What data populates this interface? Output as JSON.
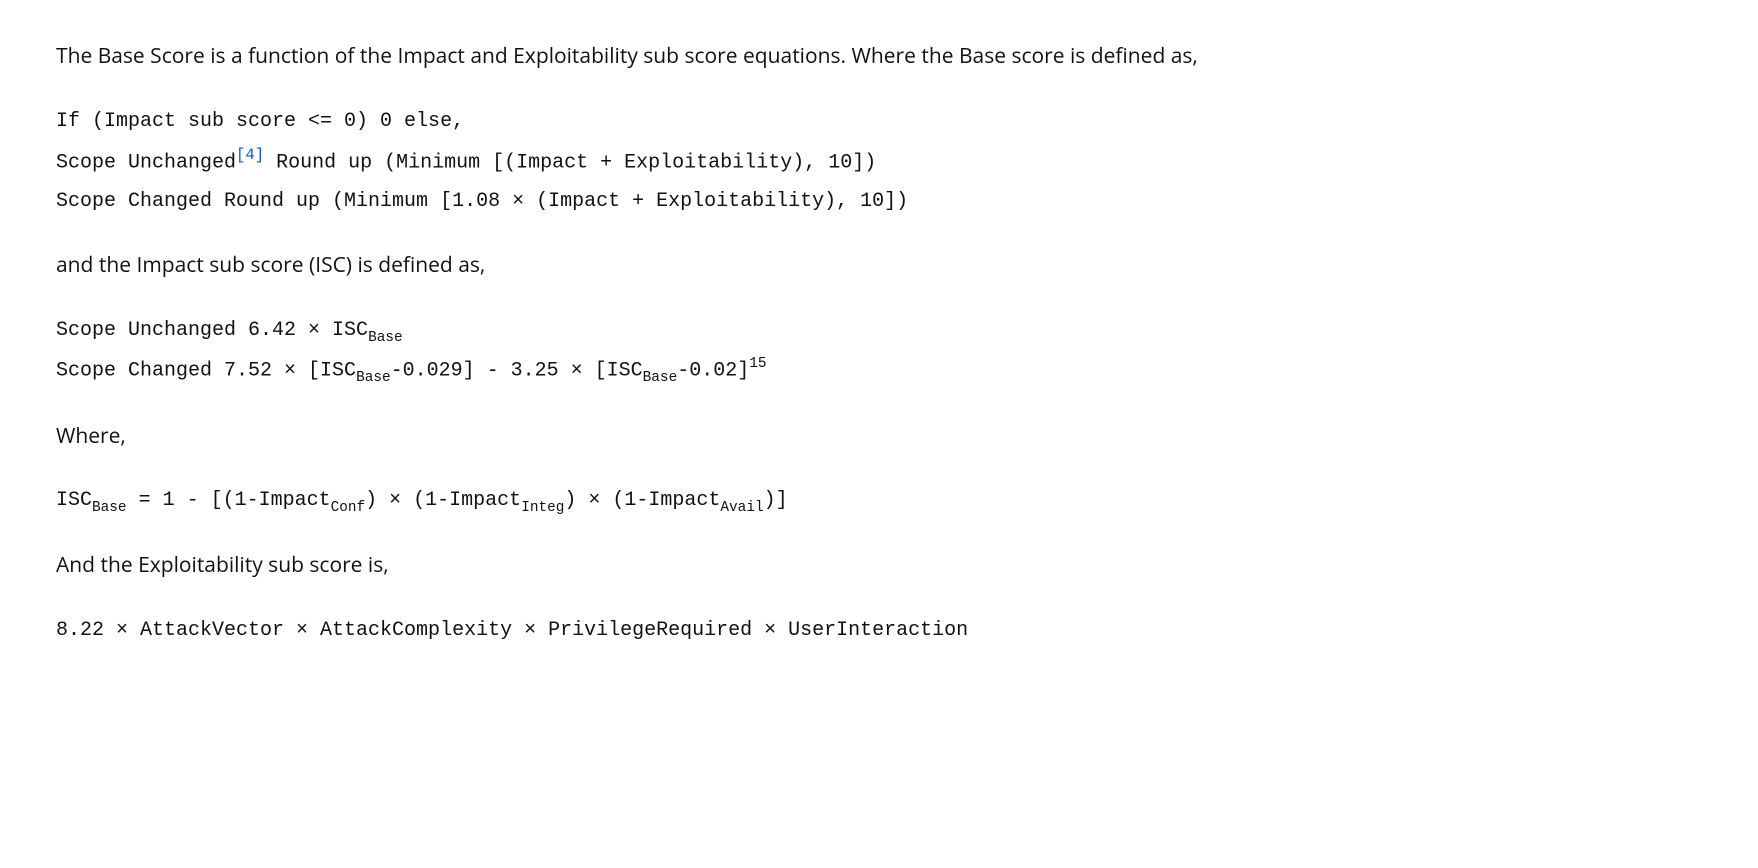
{
  "intro": "The Base Score is a function of the Impact and Exploitability sub score equations. Where the Base score is defined as,",
  "formula1": {
    "line1": "If (Impact sub score <= 0) 0 else,",
    "line2_pre": "Scope Unchanged",
    "footnote_ref": "[4]",
    "line2_post": " Round up (Minimum [(Impact + Exploitability), 10])",
    "line3": "Scope Changed Round up (Minimum [1.08 × (Impact + Exploitability), 10])"
  },
  "isc_intro": "and the Impact sub score (ISC) is defined as,",
  "formula2": {
    "line1_pre": "Scope Unchanged 6.42 × ISC",
    "line1_sub": "Base",
    "line2_a": "Scope Changed 7.52 × [ISC",
    "line2_sub1": "Base",
    "line2_b": "-0.029] - 3.25 × [ISC",
    "line2_sub2": "Base",
    "line2_c": "-0.02]",
    "line2_sup": "15"
  },
  "where": "Where,",
  "formula3": {
    "a": "ISC",
    "sub1": "Base",
    "b": " = 1 - [(1-Impact",
    "sub2": "Conf",
    "c": ") × (1-Impact",
    "sub3": "Integ",
    "d": ") × (1-Impact",
    "sub4": "Avail",
    "e": ")]"
  },
  "exploit_intro": "And the Exploitability sub score is,",
  "formula4": "8.22 × AttackVector × AttackComplexity × PrivilegeRequired × UserInteraction"
}
